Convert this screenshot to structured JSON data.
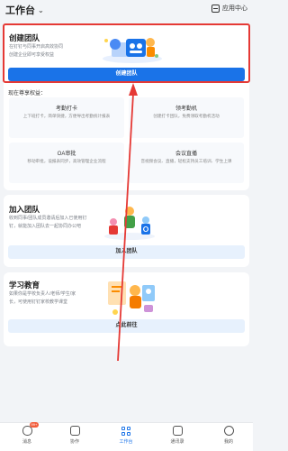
{
  "header": {
    "title": "工作台",
    "app_center": "应用中心"
  },
  "create_team": {
    "title": "创建团队",
    "desc_line1": "在钉钉与同事开启高效协同",
    "desc_line2": "创建企业即可享受权益",
    "button": "创建团队",
    "benefits_title": "现在尊享权益：",
    "benefits": [
      {
        "name": "考勤打卡",
        "desc": "上下班打卡，简单快捷，方便导出考勤统计报表"
      },
      {
        "name": "领考勤机",
        "desc": "创建打卡团队，免费领取考勤机活动"
      },
      {
        "name": "OA审批",
        "desc": "移动审批，设报表同步，高效管理企业流程"
      },
      {
        "name": "会议直播",
        "desc": "音视频会议、直播，轻松支持员工培训、学生上课"
      }
    ]
  },
  "join_team": {
    "title": "加入团队",
    "desc_line1": "收到同事/团队成员邀请后加入已使用钉",
    "desc_line2": "钉，就能加入团队去一起协同办公吧",
    "button": "加入团队"
  },
  "education": {
    "title": "学习教育",
    "desc_line1": "如果你是学校负责人/老师/学生/家",
    "desc_line2": "长，可使用钉钉家校教学课堂",
    "button": "点此前往"
  },
  "nav": [
    {
      "label": "消息",
      "badge": "99+",
      "icon": "message-icon"
    },
    {
      "label": "协作",
      "icon": "collab-icon"
    },
    {
      "label": "工作台",
      "icon": "workbench-icon"
    },
    {
      "label": "通讯录",
      "icon": "contacts-icon"
    },
    {
      "label": "我的",
      "icon": "profile-icon"
    }
  ],
  "colors": {
    "primary": "#1a73e8",
    "highlight": "#e53935",
    "badge": "#f25c3b"
  }
}
